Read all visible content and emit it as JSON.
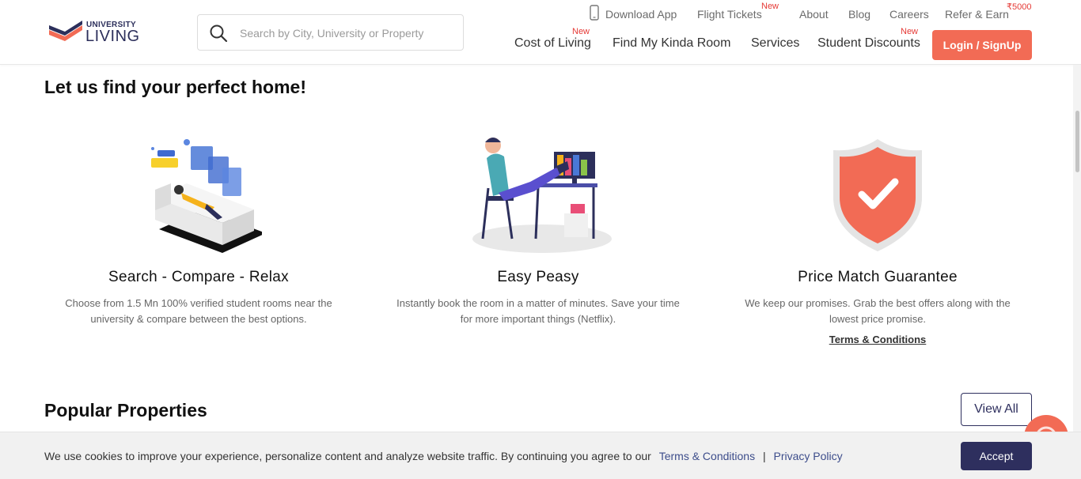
{
  "header": {
    "logo": {
      "small_text": "UNIVERSITY",
      "main_text": "LIVING"
    },
    "search": {
      "placeholder": "Search by City, University or Property"
    },
    "top_links": {
      "download_app": "Download App",
      "flight_tickets": "Flight Tickets",
      "flight_tickets_badge": "New",
      "about": "About",
      "blog": "Blog",
      "careers": "Careers",
      "refer_earn": "Refer & Earn",
      "refer_earn_badge": "₹5000"
    },
    "nav": {
      "cost_of_living": "Cost of Living",
      "cost_of_living_badge": "New",
      "find_room": "Find My Kinda Room",
      "services": "Services",
      "student_discounts": "Student Discounts",
      "student_discounts_badge": "New"
    },
    "login_label": "Login / SignUp"
  },
  "main": {
    "title": "Let us find your perfect home!",
    "features": [
      {
        "title": "Search - Compare - Relax",
        "description": "Choose from 1.5 Mn 100% verified student rooms near the university & compare between the best options."
      },
      {
        "title": "Easy Peasy",
        "description": "Instantly book the room in a matter of minutes. Save your time for more important things (Netflix)."
      },
      {
        "title": "Price Match Guarantee",
        "description": "We keep our promises. Grab the best offers along with the lowest price promise.",
        "link": "Terms & Conditions"
      }
    ],
    "popular_title": "Popular Properties",
    "view_all_label": "View All"
  },
  "cookie": {
    "text": "We use cookies to improve your experience, personalize content and analyze website traffic. By continuing you agree to our",
    "terms_link": "Terms & Conditions",
    "separator": "|",
    "privacy_link": "Privacy Policy",
    "accept_label": "Accept"
  },
  "colors": {
    "accent": "#f26b55",
    "brand_navy": "#2e2f5e",
    "badge_red": "#e53935"
  }
}
